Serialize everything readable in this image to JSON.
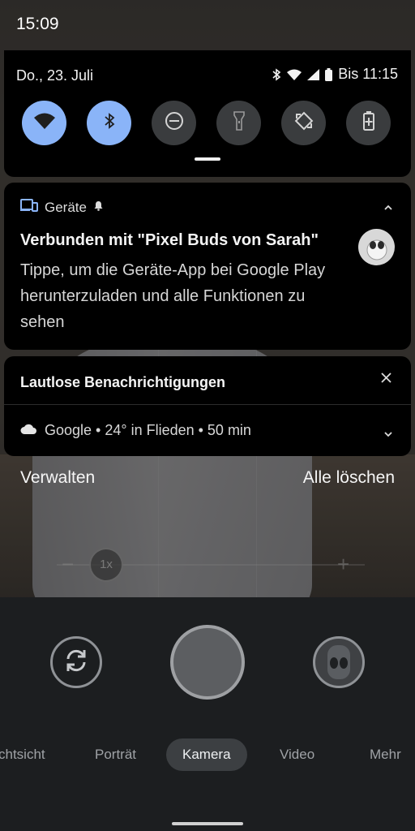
{
  "status_bar": {
    "time": "15:09"
  },
  "quick_settings": {
    "date": "Do., 23. Juli",
    "battery_text": "Bis 11:15",
    "tiles": [
      {
        "icon": "wifi-icon",
        "active": true
      },
      {
        "icon": "bluetooth-icon",
        "active": true
      },
      {
        "icon": "do-not-disturb-icon",
        "active": false
      },
      {
        "icon": "flashlight-icon",
        "active": false
      },
      {
        "icon": "auto-rotate-icon",
        "active": false
      },
      {
        "icon": "battery-saver-icon",
        "active": false
      }
    ]
  },
  "notifications": {
    "devices": {
      "app_name": "Geräte",
      "title": "Verbunden mit \"Pixel Buds von Sarah\"",
      "body": "Tippe, um die Geräte-App bei Google Play herunterzuladen und alle Funktionen zu sehen"
    },
    "silent": {
      "header": "Lautlose Benachrichtigungen",
      "weather": "Google • 24° in Flieden • 50 min"
    },
    "manage_label": "Verwalten",
    "clear_all_label": "Alle löschen"
  },
  "camera": {
    "zoom": "1x",
    "modes": [
      "chtsicht",
      "Porträt",
      "Kamera",
      "Video",
      "Mehr"
    ],
    "active_mode": "Kamera",
    "accent": "#8ab4f8"
  }
}
